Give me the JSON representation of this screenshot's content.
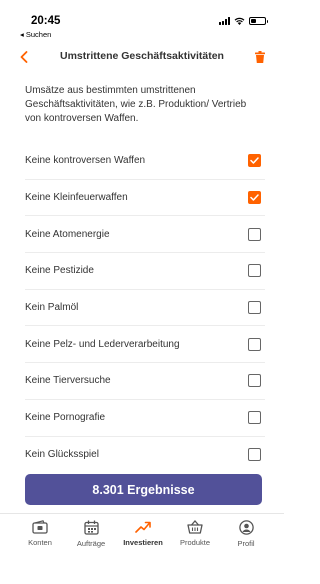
{
  "status_bar": {
    "time": "20:45",
    "back_app": "◂ Suchen"
  },
  "header": {
    "title": "Umstrittene Geschäftsaktivitäten",
    "back_icon": "chevron-left-icon",
    "trash_icon": "trash-icon"
  },
  "description": "Umsätze aus bestimmten umstrittenen Geschäftsaktivitäten, wie z.B. Produktion/ Vertrieb von kontroversen Waffen.",
  "filters": [
    {
      "label": "Keine kontroversen Waffen",
      "checked": true
    },
    {
      "label": "Keine Kleinfeuerwaffen",
      "checked": true
    },
    {
      "label": "Keine Atomenergie",
      "checked": false
    },
    {
      "label": "Keine Pestizide",
      "checked": false
    },
    {
      "label": "Kein Palmöl",
      "checked": false
    },
    {
      "label": "Keine Pelz- und Lederverarbeitung",
      "checked": false
    },
    {
      "label": "Keine Tierversuche",
      "checked": false
    },
    {
      "label": "Keine Pornografie",
      "checked": false
    },
    {
      "label": "Kein Glücksspiel",
      "checked": false
    }
  ],
  "results_button": "8.301 Ergebnisse",
  "tabs": [
    {
      "label": "Konten",
      "icon": "wallet-icon",
      "active": false
    },
    {
      "label": "Aufträge",
      "icon": "calendar-icon",
      "active": false
    },
    {
      "label": "Investieren",
      "icon": "trending-up-icon",
      "active": true
    },
    {
      "label": "Produkte",
      "icon": "basket-icon",
      "active": false
    },
    {
      "label": "Profil",
      "icon": "profile-icon",
      "active": false
    }
  ],
  "colors": {
    "accent": "#ff6200",
    "button": "#525199",
    "text": "#333333"
  }
}
